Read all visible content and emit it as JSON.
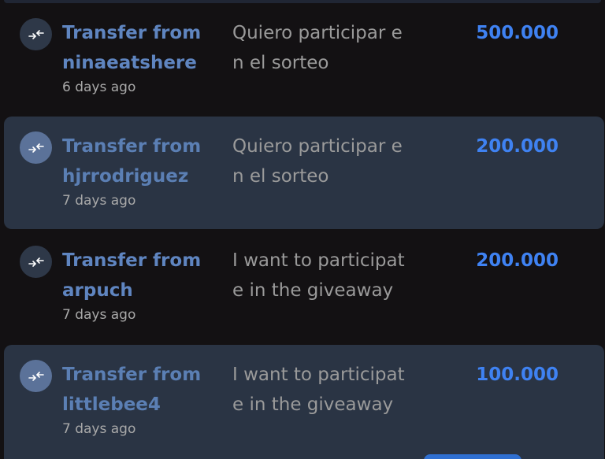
{
  "colors": {
    "background": "#131113",
    "shaded_row": "#2a3444",
    "title_link": "#5f85c0",
    "amount": "#3f82f2",
    "time": "#a9a9a9",
    "memo": "#9a9a9a"
  },
  "transactions": [
    {
      "icon": "transfer-arrows-icon",
      "title_line1": "Transfer from",
      "title_line2": "ninaeatshere",
      "time": "6 days ago",
      "memo_line1": "Quiero participar e",
      "memo_line2": "n el sorteo",
      "amount": "500.000"
    },
    {
      "icon": "transfer-arrows-icon",
      "title_line1": "Transfer from",
      "title_line2": "hjrrodriguez",
      "time": "7 days ago",
      "memo_line1": "Quiero participar e",
      "memo_line2": "n el sorteo",
      "amount": "200.000"
    },
    {
      "icon": "transfer-arrows-icon",
      "title_line1": "Transfer from",
      "title_line2": "arpuch",
      "time": "7 days ago",
      "memo_line1": "I want to participat",
      "memo_line2": "e in the giveaway",
      "amount": "200.000"
    },
    {
      "icon": "transfer-arrows-icon",
      "title_line1": "Transfer from",
      "title_line2": "littlebee4",
      "time": "7 days ago",
      "memo_line1": "I want to participat",
      "memo_line2": "e in the giveaway",
      "amount": "100.000"
    }
  ]
}
